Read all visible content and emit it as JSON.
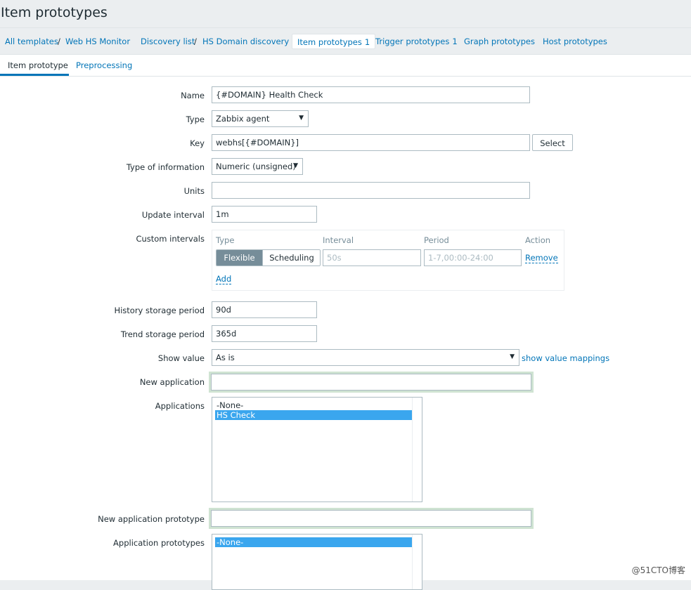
{
  "page": {
    "title": "Item prototypes"
  },
  "breadcrumbs": [
    {
      "label": "All templates"
    },
    {
      "label": "Web HS Monitor"
    },
    {
      "label": "Discovery list"
    },
    {
      "label": "HS Domain discovery"
    },
    {
      "label": "Item prototypes",
      "count": "1"
    },
    {
      "label": "Trigger prototypes",
      "count": "1"
    },
    {
      "label": "Graph prototypes"
    },
    {
      "label": "Host prototypes"
    }
  ],
  "crumb_separator": "/",
  "tabs": [
    {
      "label": "Item prototype",
      "active": true
    },
    {
      "label": "Preprocessing",
      "active": false
    }
  ],
  "form": {
    "name": {
      "label": "Name",
      "value": "{#DOMAIN} Health Check"
    },
    "type": {
      "label": "Type",
      "value": "Zabbix agent"
    },
    "key": {
      "label": "Key",
      "value": "webhs[{#DOMAIN}]",
      "button": "Select"
    },
    "type_of_information": {
      "label": "Type of information",
      "value": "Numeric (unsigned)"
    },
    "units": {
      "label": "Units",
      "value": ""
    },
    "update_interval": {
      "label": "Update interval",
      "value": "1m"
    },
    "custom_intervals": {
      "label": "Custom intervals",
      "headers": {
        "type": "Type",
        "interval": "Interval",
        "period": "Period",
        "action": "Action"
      },
      "toggle": {
        "flexible": "Flexible",
        "scheduling": "Scheduling",
        "selected": "Flexible"
      },
      "interval_placeholder": "50s",
      "period_placeholder": "1-7,00:00-24:00",
      "remove": "Remove",
      "add": "Add"
    },
    "history_storage_period": {
      "label": "History storage period",
      "value": "90d"
    },
    "trend_storage_period": {
      "label": "Trend storage period",
      "value": "365d"
    },
    "show_value": {
      "label": "Show value",
      "value": "As is",
      "link": "show value mappings"
    },
    "new_application": {
      "label": "New application",
      "value": ""
    },
    "applications": {
      "label": "Applications",
      "options": [
        "-None-",
        "HS Check"
      ],
      "selected": "HS Check"
    },
    "new_application_prototype": {
      "label": "New application prototype",
      "value": ""
    },
    "application_prototypes": {
      "label": "Application prototypes",
      "options": [
        "-None-"
      ],
      "selected": "-None-"
    }
  },
  "icons": {
    "dropdown": "chevron-down-icon"
  },
  "watermark": "@51CTO博客",
  "colors": {
    "link": "#0275b8",
    "selected_option": "#3aa6ee",
    "focus_glow": "#cfe3d2",
    "toggle_active": "#768d99"
  }
}
